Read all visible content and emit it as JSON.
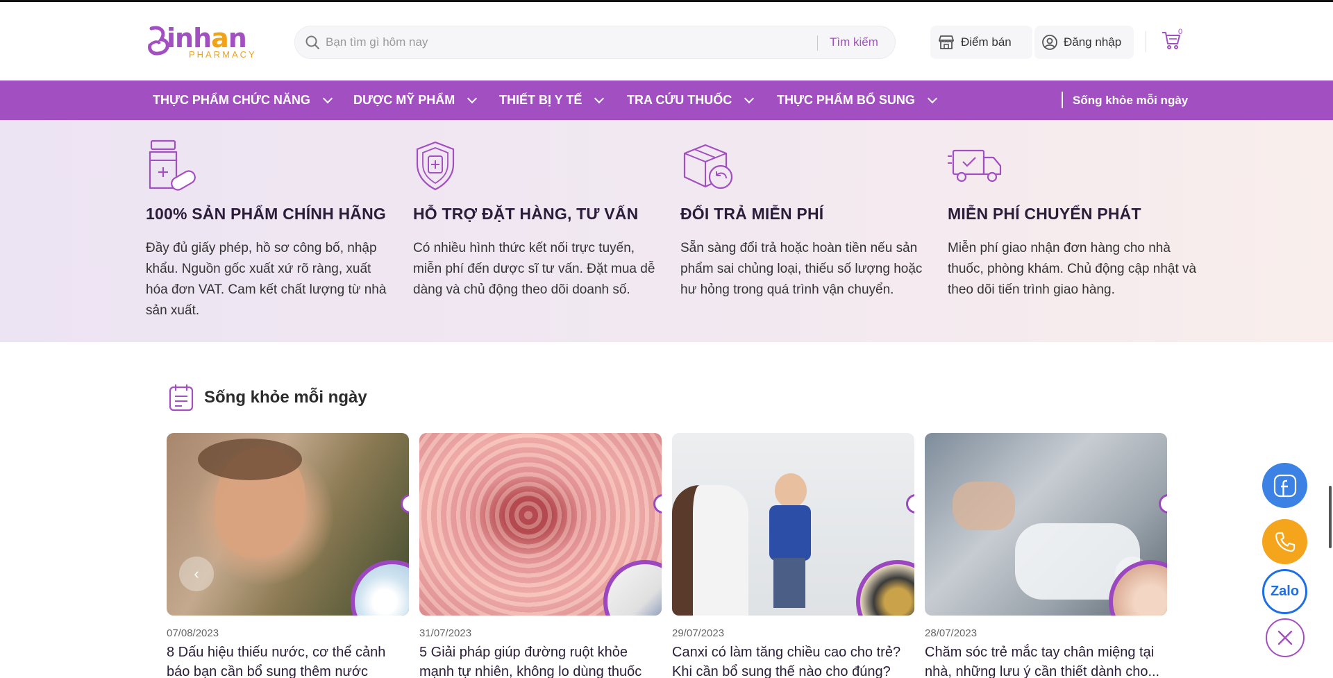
{
  "brand": {
    "name": "inhan",
    "sub": "PHARMACY",
    "colors": {
      "primary": "#a24fc1",
      "accent": "#f0a319"
    }
  },
  "header": {
    "search_placeholder": "Bạn tìm gì hôm nay",
    "search_button": "Tìm kiếm",
    "store_label": "Điểm bán",
    "login_label": "Đăng nhập",
    "cart_count": "0"
  },
  "nav": {
    "items": [
      {
        "label": "THỰC PHẨM CHỨC NĂNG"
      },
      {
        "label": "DƯỢC MỸ PHẨM"
      },
      {
        "label": "THIẾT BỊ Y TẾ"
      },
      {
        "label": "TRA CỨU THUỐC"
      },
      {
        "label": "THỰC PHẨM BỔ SUNG"
      }
    ],
    "extra": "Sống khỏe mỗi ngày"
  },
  "features": [
    {
      "icon": "medicine-bottle-icon",
      "title": "100% SẢN PHẨM CHÍNH HÃNG",
      "text": "Đầy đủ giấy phép, hồ sơ công bố, nhập khẩu. Nguồn gốc xuất xứ rõ ràng, xuất hóa đơn VAT. Cam kết chất lượng từ nhà sản xuất."
    },
    {
      "icon": "medical-shield-icon",
      "title": "HỖ TRỢ ĐẶT HÀNG, TƯ VẤN",
      "text": "Có nhiều hình thức kết nối trực tuyến, miễn phí đến dược sĩ tư vấn. Đặt mua dễ dàng và chủ động theo dõi doanh số."
    },
    {
      "icon": "box-return-icon",
      "title": "ĐỔI TRẢ MIỄN PHÍ",
      "text": "Sẵn sàng đổi trả hoặc hoàn tiền nếu sản phẩm sai chủng loại, thiếu số lượng hoặc hư hỏng trong quá trình vận chuyển."
    },
    {
      "icon": "delivery-truck-icon",
      "title": "MIỄN PHÍ CHUYỂN PHÁT",
      "text": "Miễn phí giao nhận đơn hàng cho nhà thuốc, phòng khám. Chủ động cập nhật và theo dõi tiến trình giao hàng."
    }
  ],
  "blog": {
    "heading": "Sống khỏe mỗi ngày",
    "posts": [
      {
        "date": "07/08/2023",
        "title": "8 Dấu hiệu thiếu nước, cơ thể cảnh báo bạn cần bổ sung thêm nước"
      },
      {
        "date": "31/07/2023",
        "title": "5 Giải pháp giúp đường ruột khỏe mạnh tự nhiên, không lo dùng thuốc"
      },
      {
        "date": "29/07/2023",
        "title": "Canxi có làm tăng chiều cao cho trẻ? Khi cần bổ sung thế nào cho đúng?"
      },
      {
        "date": "28/07/2023",
        "title": "Chăm sóc trẻ mắc tay chân miệng tại nhà, những lưu ý cần thiết dành cho..."
      }
    ]
  },
  "floating": {
    "zalo_label": "Zalo"
  }
}
